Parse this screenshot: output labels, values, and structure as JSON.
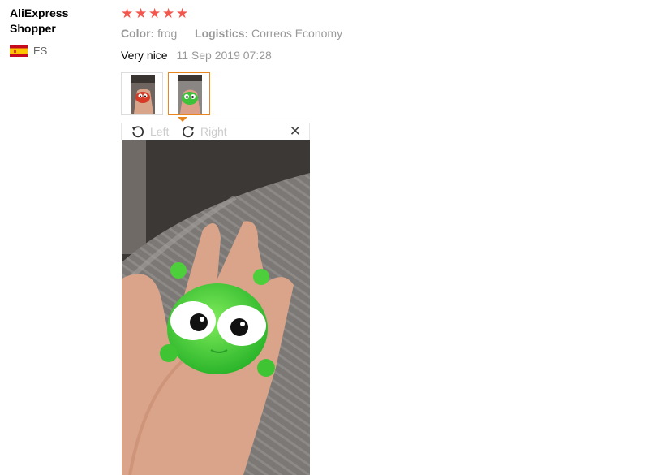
{
  "reviewer": {
    "name": "AliExpress Shopper",
    "country": "ES",
    "flag_icon": "spain-flag-icon"
  },
  "rating": {
    "stars": 5,
    "max": 5,
    "color": "#f2564d"
  },
  "attributes": [
    {
      "key": "Color:",
      "value": "frog"
    },
    {
      "key": "Logistics:",
      "value": "Correos Economy"
    }
  ],
  "review": {
    "text": "Very nice",
    "date": "11 Sep 2019 07:28"
  },
  "thumbnails": [
    {
      "name": "thumbnail-red-toy",
      "active": false
    },
    {
      "name": "thumbnail-green-frog",
      "active": true
    }
  ],
  "viewer": {
    "rotate_left_label": "Left",
    "rotate_right_label": "Right",
    "close_icon": "close-icon",
    "accent": "#e8851e"
  }
}
